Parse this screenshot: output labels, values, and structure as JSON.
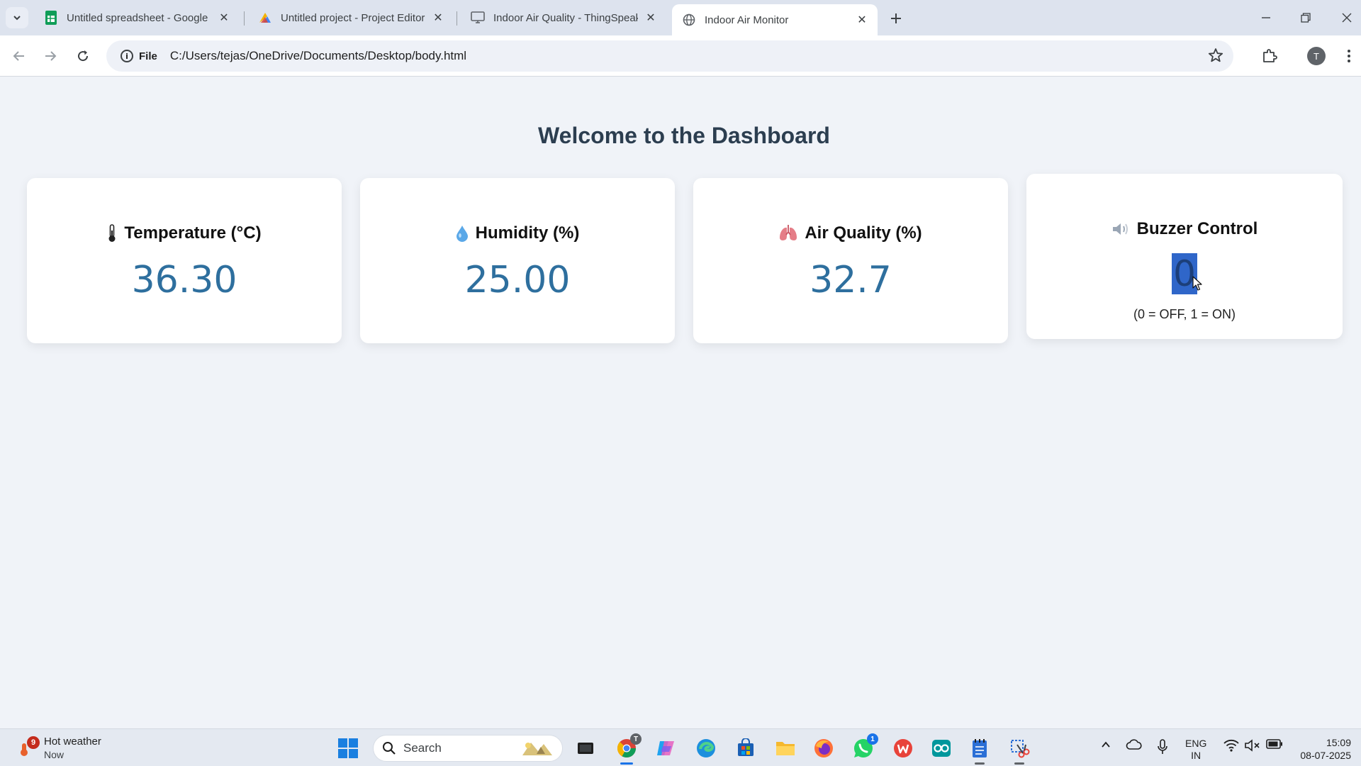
{
  "browser": {
    "tabs": [
      {
        "title": "Untitled spreadsheet - Google S",
        "icon": "sheets-icon"
      },
      {
        "title": "Untitled project - Project Editor",
        "icon": "project-editor-icon"
      },
      {
        "title": "Indoor Air Quality - ThingSpeak",
        "icon": "monitor-icon"
      },
      {
        "title": "Indoor Air Monitor",
        "icon": "globe-icon",
        "active": true
      }
    ],
    "address": {
      "chip_label": "File",
      "url": "C:/Users/tejas/OneDrive/Documents/Desktop/body.html"
    },
    "profile_initial": "T"
  },
  "page": {
    "title": "Welcome to the Dashboard",
    "cards": {
      "temperature": {
        "icon": "🌡",
        "label": "Temperature (°C)",
        "value": "36.30"
      },
      "humidity": {
        "icon": "💧",
        "label": "Humidity (%)",
        "value": "25.00"
      },
      "air_quality": {
        "icon": "🫁",
        "label": "Air Quality (%)",
        "value": "32.7"
      },
      "buzzer": {
        "icon": "🔈",
        "label": "Buzzer Control",
        "value": "0",
        "hint": "(0 = OFF, 1 = ON)"
      }
    }
  },
  "taskbar": {
    "weather": {
      "badge": "9",
      "title": "Hot weather",
      "subtitle": "Now"
    },
    "search_label": "Search",
    "chrome_badge": "T",
    "whatsapp_badge": "1",
    "lang_line1": "ENG",
    "lang_line2": "IN",
    "time": "15:09",
    "date": "08-07-2025"
  },
  "colors": {
    "value_blue": "#2e6f9e",
    "title_color": "#2c3e50",
    "page_bg": "#f0f3f8",
    "selection_blue": "#2f66c9"
  }
}
